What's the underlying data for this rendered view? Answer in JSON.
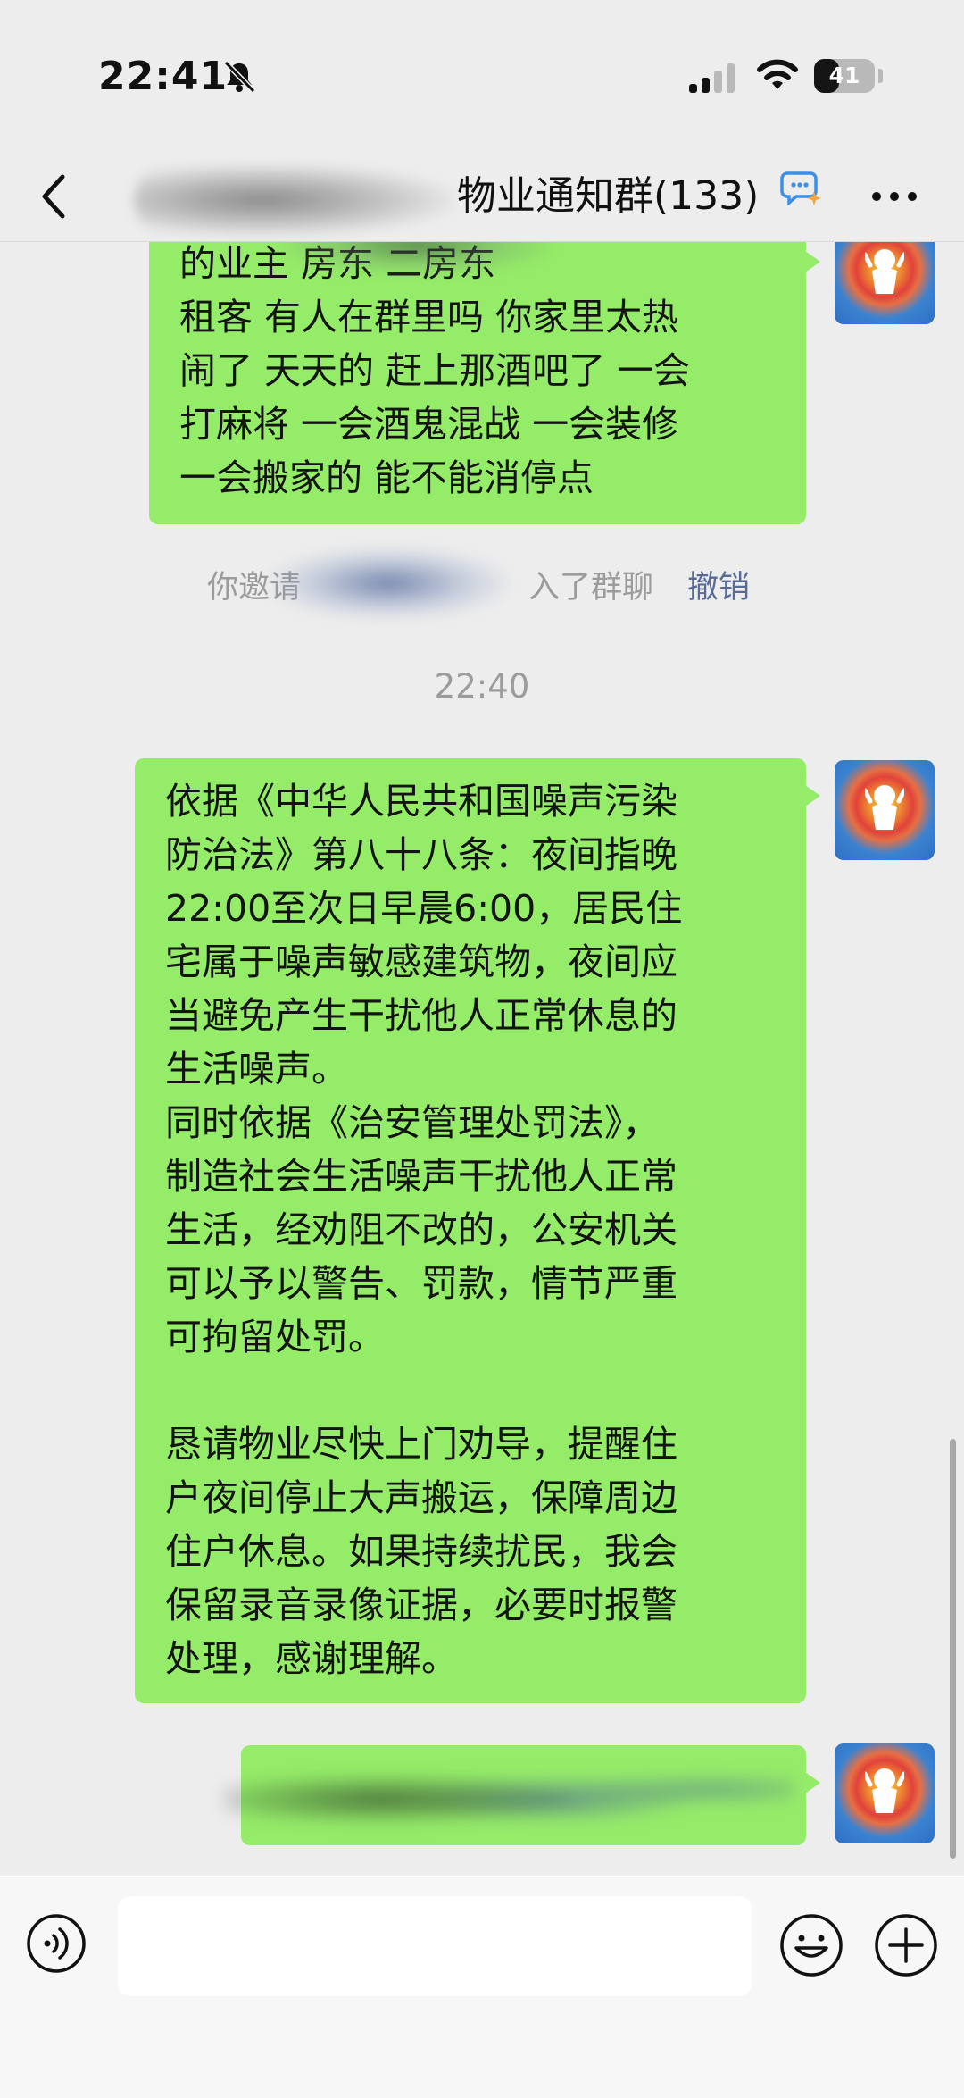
{
  "status_bar": {
    "time": "22:41",
    "battery_level": "41",
    "battery_fraction": 0.41
  },
  "header": {
    "title": "物业通知群(133)",
    "icons": [
      "back-icon",
      "ai-assistant-icon",
      "more-icon"
    ]
  },
  "messages": [
    {
      "type": "text",
      "sender": "self",
      "text": "的业主 房东 二房东\n租客 有人在群里吗 你家里太热\n闹了 天天的 赶上那酒吧了 一会\n打麻将 一会酒鬼混战 一会装修\n一会搬家的 能不能消停点"
    },
    {
      "type": "system",
      "text_before": "你邀请",
      "text_after": "入了群聊",
      "action": "撤销"
    },
    {
      "type": "timestamp",
      "text": "22:40"
    },
    {
      "type": "text",
      "sender": "self",
      "text": "依据《中华人民共和国噪声污染\n防治法》第八十八条：夜间指晚\n22:00至次日早晨6:00，居民住\n宅属于噪声敏感建筑物，夜间应\n当避免产生干扰他人正常休息的\n生活噪声。\n同时依据《治安管理处罚法》，\n制造社会生活噪声干扰他人正常\n生活，经劝阻不改的，公安机关\n可以予以警告、罚款，情节严重\n可拘留处罚。\n\n恳请物业尽快上门劝导，提醒住\n户夜间停止大声搬运，保障周边\n住户休息。如果持续扰民，我会\n保留录音录像证据，必要时报警\n处理，感谢理解。"
    },
    {
      "type": "text",
      "sender": "self",
      "text": ""
    }
  ],
  "input_bar": {
    "value": "",
    "icons": [
      "voice-icon",
      "emoji-icon",
      "plus-icon"
    ]
  },
  "colors": {
    "background": "#ededed",
    "bubble_self": "#95ec69",
    "system_text": "#9b9b9b",
    "link": "#576b95"
  }
}
